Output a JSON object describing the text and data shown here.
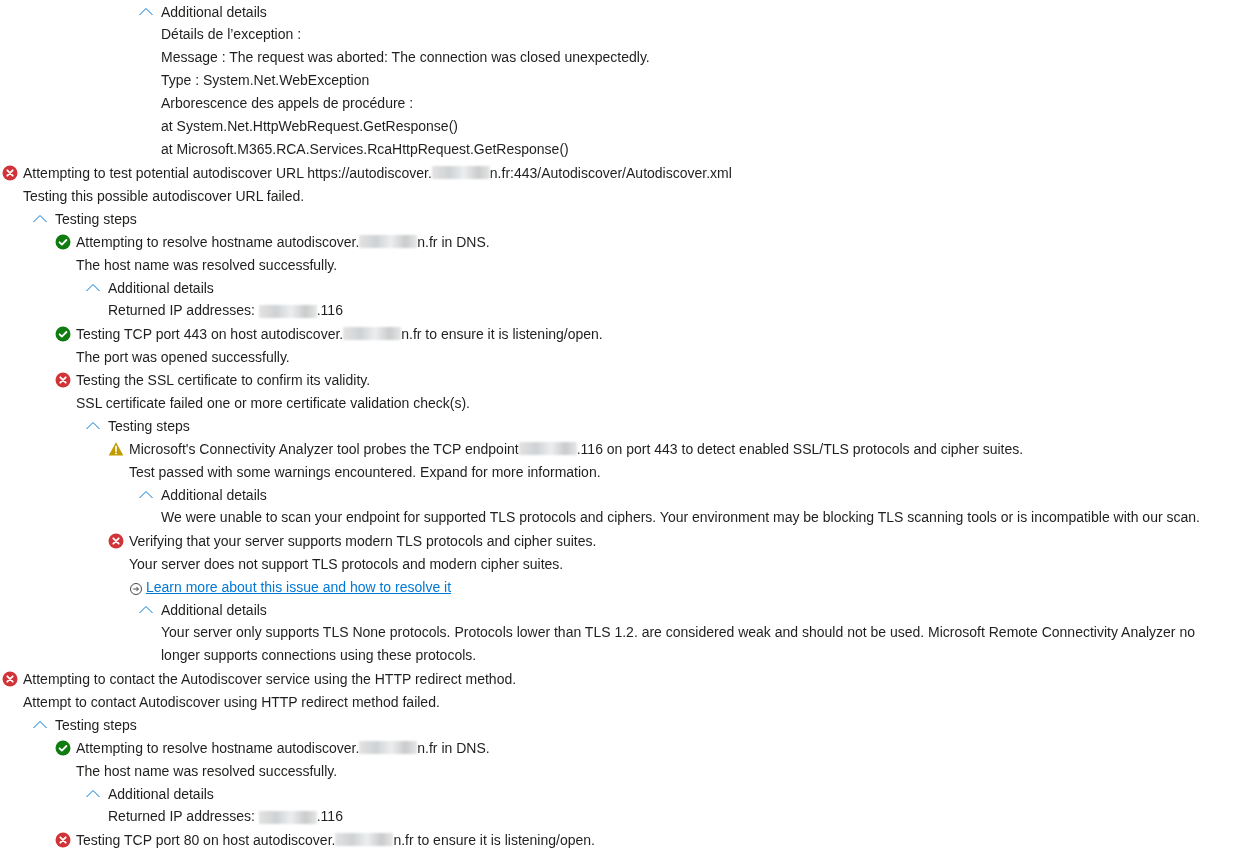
{
  "results": [
    {
      "kind": "step",
      "children": [
        {
          "kind": "section",
          "children": [
            {
              "kind": "step",
              "children": [
                {
                  "kind": "section",
                  "children": [
                    {
                      "kind": "step",
                      "children": [
                        {
                          "kind": "section",
                          "label": "Additional details",
                          "expanded": true,
                          "lines": [
                            {
                              "text": [
                                "Détails de l’exception :"
                              ]
                            },
                            {
                              "text": [
                                "Message : The request was aborted: The connection was closed unexpectedly."
                              ]
                            },
                            {
                              "text": [
                                "Type : System.Net.WebException"
                              ]
                            },
                            {
                              "text": [
                                "Arborescence des appels de procédure :"
                              ]
                            },
                            {
                              "text": [
                                "at System.Net.HttpWebRequest.GetResponse()"
                              ]
                            },
                            {
                              "text": [
                                "at Microsoft.M365.RCA.Services.RcaHttpRequest.GetResponse()"
                              ]
                            }
                          ]
                        }
                      ]
                    }
                  ]
                }
              ]
            }
          ]
        }
      ]
    },
    {
      "kind": "error",
      "title": [
        "Attempting to test potential autodiscover URL https://autodiscover.",
        "n.fr:443/Autodiscover/Autodiscover.xml"
      ],
      "description": "Testing this possible autodiscover URL failed.",
      "children": [
        {
          "kind": "section",
          "label": "Testing steps",
          "expanded": true,
          "children": [
            {
              "kind": "success",
              "title": [
                "Attempting to resolve hostname autodiscover.",
                "n.fr in DNS."
              ],
              "description": "The host name was resolved successfully.",
              "children": [
                {
                  "kind": "section",
                  "label": "Additional details",
                  "expanded": true,
                  "lines": [
                    {
                      "text": [
                        "Returned IP addresses: ",
                        ".116"
                      ]
                    }
                  ]
                }
              ]
            },
            {
              "kind": "success",
              "title": [
                "Testing TCP port 443 on host autodiscover.",
                "n.fr to ensure it is listening/open."
              ],
              "description": "The port was opened successfully."
            },
            {
              "kind": "error",
              "title": [
                "Testing the SSL certificate to confirm its validity."
              ],
              "description": "SSL certificate failed one or more certificate validation check(s).",
              "children": [
                {
                  "kind": "section",
                  "label": "Testing steps",
                  "expanded": true,
                  "children": [
                    {
                      "kind": "warning",
                      "title": [
                        "Microsoft's Connectivity Analyzer tool probes the TCP endpoint ",
                        ".116 on port 443 to detect enabled SSL/TLS protocols and cipher suites."
                      ],
                      "description": "Test passed with some warnings encountered. Expand for more information.",
                      "children": [
                        {
                          "kind": "section",
                          "label": "Additional details",
                          "expanded": true,
                          "lines": [
                            {
                              "text": [
                                "We were unable to scan your endpoint for supported TLS protocols and ciphers. Your environment may be blocking TLS scanning tools or is incompatible with our scan."
                              ]
                            }
                          ]
                        }
                      ]
                    },
                    {
                      "kind": "error",
                      "title": [
                        "Verifying that your server supports modern TLS protocols and cipher suites."
                      ],
                      "description": "Your server does not support TLS protocols and modern cipher suites.",
                      "link": "Learn more about this issue and how to resolve it",
                      "children": [
                        {
                          "kind": "section",
                          "label": "Additional details",
                          "expanded": true,
                          "lines": [
                            {
                              "text": [
                                "Your server only supports TLS None protocols. Protocols lower than TLS 1.2. are considered weak and should not be used. Microsoft Remote Connectivity Analyzer no longer supports connections using these protocols."
                              ]
                            }
                          ]
                        }
                      ]
                    }
                  ]
                }
              ]
            }
          ]
        }
      ]
    },
    {
      "kind": "error",
      "title": [
        "Attempting to contact the Autodiscover service using the HTTP redirect method."
      ],
      "description": "Attempt to contact Autodiscover using HTTP redirect method failed.",
      "children": [
        {
          "kind": "section",
          "label": "Testing steps",
          "expanded": true,
          "children": [
            {
              "kind": "success",
              "title": [
                "Attempting to resolve hostname autodiscover.",
                "n.fr in DNS."
              ],
              "description": "The host name was resolved successfully.",
              "children": [
                {
                  "kind": "section",
                  "label": "Additional details",
                  "expanded": true,
                  "lines": [
                    {
                      "text": [
                        "Returned IP addresses: ",
                        ".116"
                      ]
                    }
                  ]
                }
              ]
            },
            {
              "kind": "error",
              "title": [
                "Testing TCP port 80 on host autodiscover.",
                "n.fr to ensure it is listening/open."
              ]
            }
          ]
        }
      ]
    }
  ]
}
